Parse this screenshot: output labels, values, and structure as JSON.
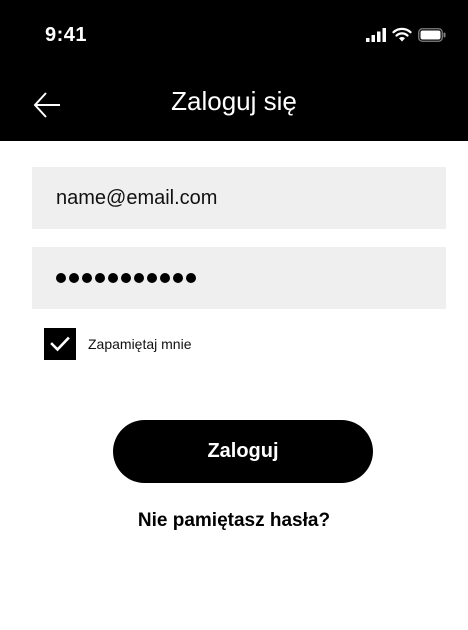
{
  "status_bar": {
    "time": "9:41",
    "icons": [
      "cellular-signal-icon",
      "wifi-icon",
      "battery-icon"
    ]
  },
  "header": {
    "back_icon": "arrow-left-icon",
    "title": "Zaloguj się",
    "background": "#000000"
  },
  "form": {
    "email_value": "name@email.com",
    "password_masked": "●●●●●●●●●●●",
    "password_length": 11,
    "remember_label": "Zapamiętaj mnie",
    "remember_checked": true
  },
  "actions": {
    "login_label": "Zaloguj",
    "forgot_label": "Nie pamiętasz hasła?"
  },
  "colors": {
    "primary": "#000000",
    "field_bg": "#efefef",
    "text": "#111111"
  }
}
